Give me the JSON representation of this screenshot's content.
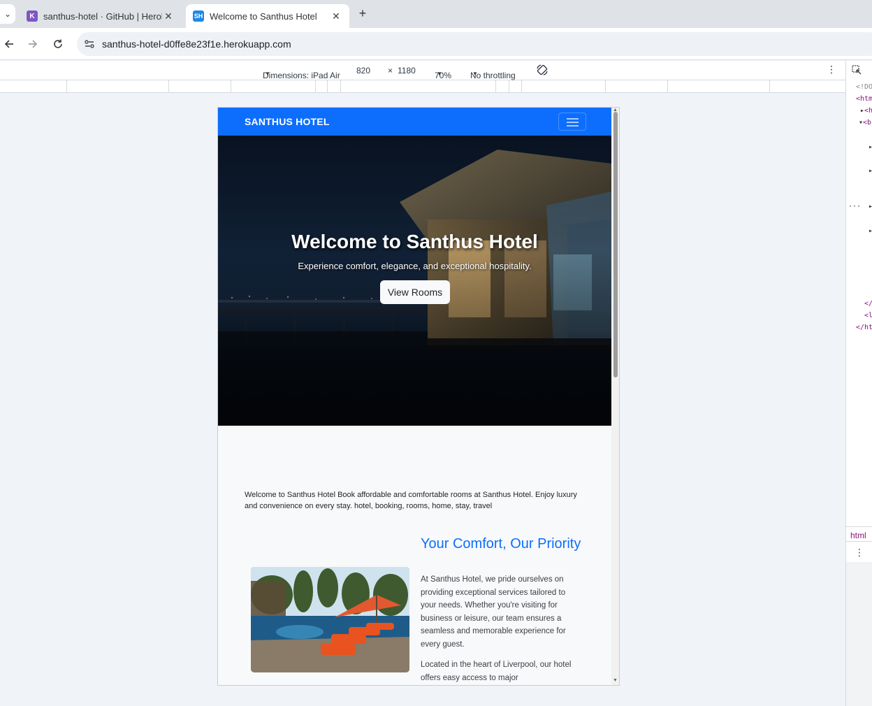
{
  "browser": {
    "tabs": [
      {
        "title": "santhus-hotel · GitHub | Heroku",
        "favicon": "K",
        "close": "✕"
      },
      {
        "title": "Welcome to Santhus Hotel",
        "favicon": "SH",
        "close": "✕"
      }
    ],
    "new_tab": "+",
    "tab_menu": "⌄",
    "url": "santhus-hotel-d0ffe8e23f1e.herokuapp.com"
  },
  "device_toolbar": {
    "dimensions_label": "Dimensions: iPad Air",
    "width": "820",
    "times": "×",
    "height": "1180",
    "zoom": "70%",
    "throttling": "No throttling",
    "menu": "⋮"
  },
  "devtools": {
    "lines": [
      "<!DO",
      "<htm",
      "<h",
      "<b",
      "</",
      "<l",
      "</ht"
    ],
    "ellipsis": "···",
    "footer": "html",
    "menu": "⋮"
  },
  "site": {
    "brand": "SANTHUS HOTEL",
    "hero_title": "Welcome to Santhus Hotel",
    "hero_subtitle": "Experience comfort, elegance, and exceptional hospitality.",
    "hero_button": "View Rooms",
    "intro": "Welcome to Santhus Hotel Book affordable and comfortable rooms at Santhus Hotel. Enjoy luxury and convenience on every stay. hotel, booking, rooms, home, stay, travel",
    "section_title": "Your Comfort, Our Priority",
    "section_p1": "At Santhus Hotel, we pride ourselves on providing exceptional services tailored to your needs. Whether you're visiting for business or leisure, our team ensures a seamless and memorable experience for every guest.",
    "section_p2": "Located in the heart of Liverpool, our hotel offers easy access to major"
  },
  "colors": {
    "brand_blue": "#0d6efd",
    "page_bg": "#f8f9fa"
  }
}
